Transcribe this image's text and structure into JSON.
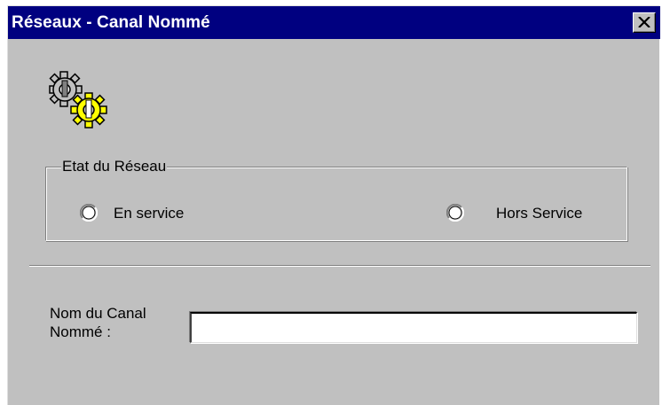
{
  "window": {
    "title": "Réseaux - Canal Nommé",
    "close_icon": "close-icon"
  },
  "header_icon": "gears-icon",
  "network_state": {
    "legend": "Etat du Réseau",
    "options": [
      {
        "label": "En service",
        "selected": false
      },
      {
        "label": "Hors Service",
        "selected": false
      }
    ]
  },
  "pipe_name": {
    "label_line1": "Nom du Canal",
    "label_line2": "Nommé :",
    "value": "",
    "placeholder": ""
  },
  "colors": {
    "titlebar": "#000080",
    "title_text": "#ffffff",
    "dialog_face": "#c0c0c0",
    "gear_yellow": "#ffff00"
  }
}
